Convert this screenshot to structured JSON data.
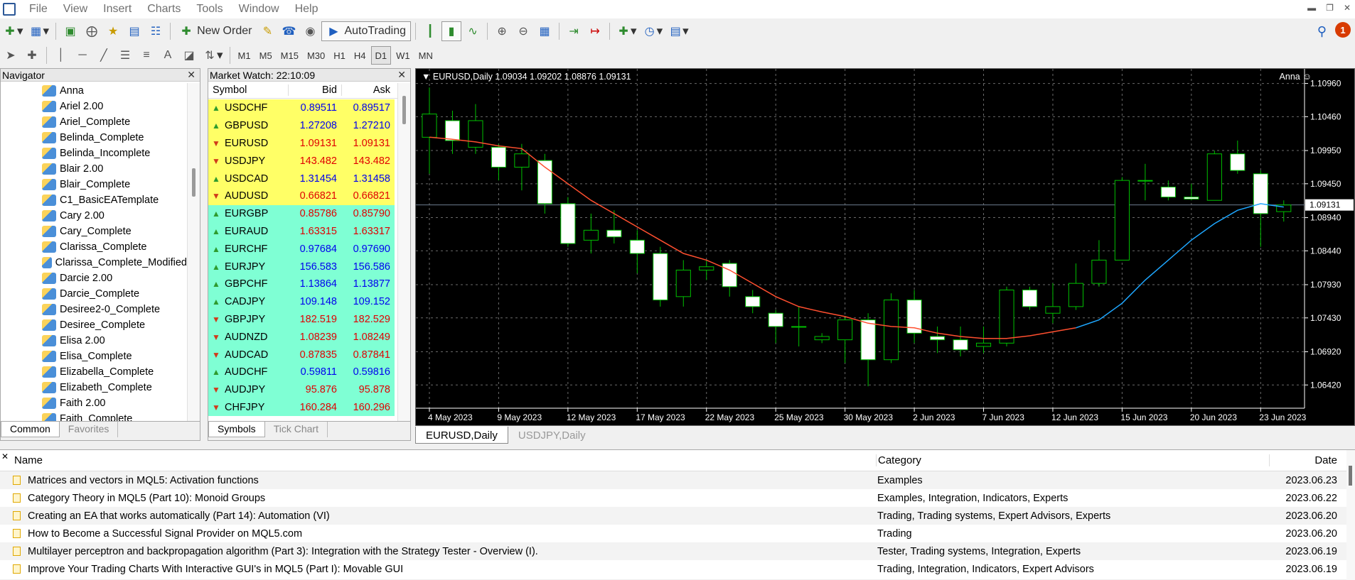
{
  "menu": [
    "File",
    "View",
    "Insert",
    "Charts",
    "Tools",
    "Window",
    "Help"
  ],
  "toolbar": {
    "new_order": "New Order",
    "autotrading": "AutoTrading"
  },
  "timeframes": [
    "M1",
    "M5",
    "M15",
    "M30",
    "H1",
    "H4",
    "D1",
    "W1",
    "MN"
  ],
  "active_timeframe": "D1",
  "alert_count": "1",
  "navigator": {
    "title": "Navigator",
    "items": [
      "Anna",
      "Ariel 2.00",
      "Ariel_Complete",
      "Belinda_Complete",
      "Belinda_Incomplete",
      "Blair 2.00",
      "Blair_Complete",
      "C1_BasicEATemplate",
      "Cary 2.00",
      "Cary_Complete",
      "Clarissa_Complete",
      "Clarissa_Complete_Modified",
      "Darcie 2.00",
      "Darcie_Complete",
      "Desiree2-0_Complete",
      "Desiree_Complete",
      "Elisa 2.00",
      "Elisa_Complete",
      "Elizabella_Complete",
      "Elizabeth_Complete",
      "Faith 2.00",
      "Faith_Complete"
    ],
    "tabs": [
      "Common",
      "Favorites"
    ]
  },
  "market_watch": {
    "title": "Market Watch: 22:10:09",
    "columns": [
      "Symbol",
      "Bid",
      "Ask"
    ],
    "rows": [
      {
        "symbol": "USDCHF",
        "bid": "0.89511",
        "ask": "0.89517",
        "dir": "up",
        "bg": "#ffff66",
        "color": "#0000ee"
      },
      {
        "symbol": "GBPUSD",
        "bid": "1.27208",
        "ask": "1.27210",
        "dir": "up",
        "bg": "#ffff66",
        "color": "#0000ee"
      },
      {
        "symbol": "EURUSD",
        "bid": "1.09131",
        "ask": "1.09131",
        "dir": "dn",
        "bg": "#ffff66",
        "color": "#e00000"
      },
      {
        "symbol": "USDJPY",
        "bid": "143.482",
        "ask": "143.482",
        "dir": "dn",
        "bg": "#ffff66",
        "color": "#e00000"
      },
      {
        "symbol": "USDCAD",
        "bid": "1.31454",
        "ask": "1.31458",
        "dir": "up",
        "bg": "#ffff66",
        "color": "#0000ee"
      },
      {
        "symbol": "AUDUSD",
        "bid": "0.66821",
        "ask": "0.66821",
        "dir": "dn",
        "bg": "#ffff66",
        "color": "#e00000"
      },
      {
        "symbol": "EURGBP",
        "bid": "0.85786",
        "ask": "0.85790",
        "dir": "up",
        "bg": "#7fffd4",
        "color": "#e00000"
      },
      {
        "symbol": "EURAUD",
        "bid": "1.63315",
        "ask": "1.63317",
        "dir": "up",
        "bg": "#7fffd4",
        "color": "#e00000"
      },
      {
        "symbol": "EURCHF",
        "bid": "0.97684",
        "ask": "0.97690",
        "dir": "up",
        "bg": "#7fffd4",
        "color": "#0000ee"
      },
      {
        "symbol": "EURJPY",
        "bid": "156.583",
        "ask": "156.586",
        "dir": "up",
        "bg": "#7fffd4",
        "color": "#0000ee"
      },
      {
        "symbol": "GBPCHF",
        "bid": "1.13864",
        "ask": "1.13877",
        "dir": "up",
        "bg": "#7fffd4",
        "color": "#0000ee"
      },
      {
        "symbol": "CADJPY",
        "bid": "109.148",
        "ask": "109.152",
        "dir": "up",
        "bg": "#7fffd4",
        "color": "#0000ee"
      },
      {
        "symbol": "GBPJPY",
        "bid": "182.519",
        "ask": "182.529",
        "dir": "dn",
        "bg": "#7fffd4",
        "color": "#e00000"
      },
      {
        "symbol": "AUDNZD",
        "bid": "1.08239",
        "ask": "1.08249",
        "dir": "dn",
        "bg": "#7fffd4",
        "color": "#e00000"
      },
      {
        "symbol": "AUDCAD",
        "bid": "0.87835",
        "ask": "0.87841",
        "dir": "dn",
        "bg": "#7fffd4",
        "color": "#e00000"
      },
      {
        "symbol": "AUDCHF",
        "bid": "0.59811",
        "ask": "0.59816",
        "dir": "up",
        "bg": "#7fffd4",
        "color": "#0000ee"
      },
      {
        "symbol": "AUDJPY",
        "bid": "95.876",
        "ask": "95.878",
        "dir": "dn",
        "bg": "#7fffd4",
        "color": "#e00000"
      },
      {
        "symbol": "CHFJPY",
        "bid": "160.284",
        "ask": "160.296",
        "dir": "dn",
        "bg": "#7fffd4",
        "color": "#e00000"
      }
    ],
    "tabs": [
      "Symbols",
      "Tick Chart"
    ]
  },
  "chart": {
    "header": "EURUSD,Daily  1.09034 1.09202 1.08876 1.09131",
    "user": "Anna",
    "current_price": "1.09131",
    "tabs": [
      "EURUSD,Daily",
      "USDJPY,Daily"
    ]
  },
  "chart_data": {
    "type": "candlestick",
    "symbol": "EURUSD",
    "timeframe": "Daily",
    "ylim": [
      1.0607,
      1.1118
    ],
    "y_ticks": [
      "1.10960",
      "1.10460",
      "1.09950",
      "1.09450",
      "1.08940",
      "1.08440",
      "1.07930",
      "1.07430",
      "1.06920",
      "1.06420"
    ],
    "x_ticks": [
      "4 May 2023",
      "9 May 2023",
      "12 May 2023",
      "17 May 2023",
      "22 May 2023",
      "25 May 2023",
      "30 May 2023",
      "2 Jun 2023",
      "7 Jun 2023",
      "12 Jun 2023",
      "15 Jun 2023",
      "20 Jun 2023",
      "23 Jun 2023"
    ],
    "candles": [
      {
        "o": 1.1015,
        "h": 1.109,
        "l": 1.096,
        "c": 1.105
      },
      {
        "o": 1.104,
        "h": 1.1055,
        "l": 1.099,
        "c": 1.101
      },
      {
        "o": 1.1,
        "h": 1.1065,
        "l": 1.099,
        "c": 1.104
      },
      {
        "o": 1.1,
        "h": 1.1005,
        "l": 1.095,
        "c": 1.097
      },
      {
        "o": 1.097,
        "h": 1.1005,
        "l": 1.0935,
        "c": 1.099
      },
      {
        "o": 1.098,
        "h": 1.099,
        "l": 1.09,
        "c": 1.0915
      },
      {
        "o": 1.0915,
        "h": 1.0925,
        "l": 1.085,
        "c": 1.0855
      },
      {
        "o": 1.086,
        "h": 1.09,
        "l": 1.084,
        "c": 1.0875
      },
      {
        "o": 1.0875,
        "h": 1.0905,
        "l": 1.0855,
        "c": 1.0865
      },
      {
        "o": 1.086,
        "h": 1.0875,
        "l": 1.081,
        "c": 1.084
      },
      {
        "o": 1.084,
        "h": 1.085,
        "l": 1.076,
        "c": 1.077
      },
      {
        "o": 1.0775,
        "h": 1.083,
        "l": 1.076,
        "c": 1.0815
      },
      {
        "o": 1.0815,
        "h": 1.083,
        "l": 1.08,
        "c": 1.082
      },
      {
        "o": 1.0825,
        "h": 1.083,
        "l": 1.0775,
        "c": 1.079
      },
      {
        "o": 1.0775,
        "h": 1.0785,
        "l": 1.075,
        "c": 1.076
      },
      {
        "o": 1.075,
        "h": 1.0755,
        "l": 1.0705,
        "c": 1.073
      },
      {
        "o": 1.073,
        "h": 1.076,
        "l": 1.07,
        "c": 1.073
      },
      {
        "o": 1.071,
        "h": 1.072,
        "l": 1.0705,
        "c": 1.0715
      },
      {
        "o": 1.071,
        "h": 1.0745,
        "l": 1.0675,
        "c": 1.074
      },
      {
        "o": 1.074,
        "h": 1.075,
        "l": 1.064,
        "c": 1.068
      },
      {
        "o": 1.068,
        "h": 1.078,
        "l": 1.0675,
        "c": 1.077
      },
      {
        "o": 1.077,
        "h": 1.0785,
        "l": 1.0705,
        "c": 1.072
      },
      {
        "o": 1.0715,
        "h": 1.073,
        "l": 1.069,
        "c": 1.071
      },
      {
        "o": 1.071,
        "h": 1.073,
        "l": 1.0685,
        "c": 1.0695
      },
      {
        "o": 1.07,
        "h": 1.073,
        "l": 1.069,
        "c": 1.0705
      },
      {
        "o": 1.0705,
        "h": 1.079,
        "l": 1.07,
        "c": 1.0785
      },
      {
        "o": 1.0785,
        "h": 1.079,
        "l": 1.0755,
        "c": 1.076
      },
      {
        "o": 1.075,
        "h": 1.0795,
        "l": 1.0735,
        "c": 1.076
      },
      {
        "o": 1.076,
        "h": 1.0825,
        "l": 1.0755,
        "c": 1.0795
      },
      {
        "o": 1.0795,
        "h": 1.086,
        "l": 1.079,
        "c": 1.083
      },
      {
        "o": 1.083,
        "h": 1.0955,
        "l": 1.083,
        "c": 1.095
      },
      {
        "o": 1.095,
        "h": 1.0975,
        "l": 1.092,
        "c": 1.095
      },
      {
        "o": 1.094,
        "h": 1.095,
        "l": 1.092,
        "c": 1.0925
      },
      {
        "o": 1.0925,
        "h": 1.0945,
        "l": 1.092,
        "c": 1.0922
      },
      {
        "o": 1.092,
        "h": 1.0995,
        "l": 1.092,
        "c": 1.099
      },
      {
        "o": 1.099,
        "h": 1.101,
        "l": 1.096,
        "c": 1.0965
      },
      {
        "o": 1.096,
        "h": 1.0965,
        "l": 1.085,
        "c": 1.09
      },
      {
        "o": 1.0903,
        "h": 1.092,
        "l": 1.0888,
        "c": 1.0913
      }
    ],
    "ma": [
      1.1015,
      1.1012,
      1.1008,
      1.1002,
      1.0998,
      1.097,
      1.0945,
      1.092,
      1.09,
      1.088,
      1.086,
      1.084,
      1.083,
      1.0815,
      1.0795,
      1.0775,
      1.076,
      1.0752,
      1.0745,
      1.0735,
      1.073,
      1.0728,
      1.072,
      1.0715,
      1.0712,
      1.0712,
      1.0716,
      1.0722,
      1.0728,
      1.074,
      1.0765,
      1.08,
      1.083,
      1.086,
      1.0885,
      1.0905,
      1.0915,
      1.091
    ],
    "ma_color_down": "#ff4f2f",
    "ma_color_up": "#1ea7ff",
    "up_color": "#00c000",
    "bg": "#000000"
  },
  "articles": {
    "columns": [
      "Name",
      "Category",
      "Date"
    ],
    "rows": [
      {
        "name": "Matrices and vectors in MQL5: Activation functions",
        "cat": "Examples",
        "date": "2023.06.23"
      },
      {
        "name": "Category Theory in MQL5 (Part 10): Monoid Groups",
        "cat": "Examples, Integration, Indicators, Experts",
        "date": "2023.06.22"
      },
      {
        "name": "Creating an EA that works automatically (Part 14): Automation (VI)",
        "cat": "Trading, Trading systems, Expert Advisors, Experts",
        "date": "2023.06.20"
      },
      {
        "name": "How to Become a Successful Signal Provider on MQL5.com",
        "cat": "Trading",
        "date": "2023.06.20"
      },
      {
        "name": "Multilayer perceptron and backpropagation algorithm (Part 3): Integration with the Strategy Tester - Overview (I).",
        "cat": "Tester, Trading systems, Integration, Experts",
        "date": "2023.06.19"
      },
      {
        "name": "Improve Your Trading Charts With Interactive GUI's in MQL5 (Part I): Movable GUI",
        "cat": "Trading, Integration, Indicators, Expert Advisors",
        "date": "2023.06.19"
      }
    ]
  }
}
